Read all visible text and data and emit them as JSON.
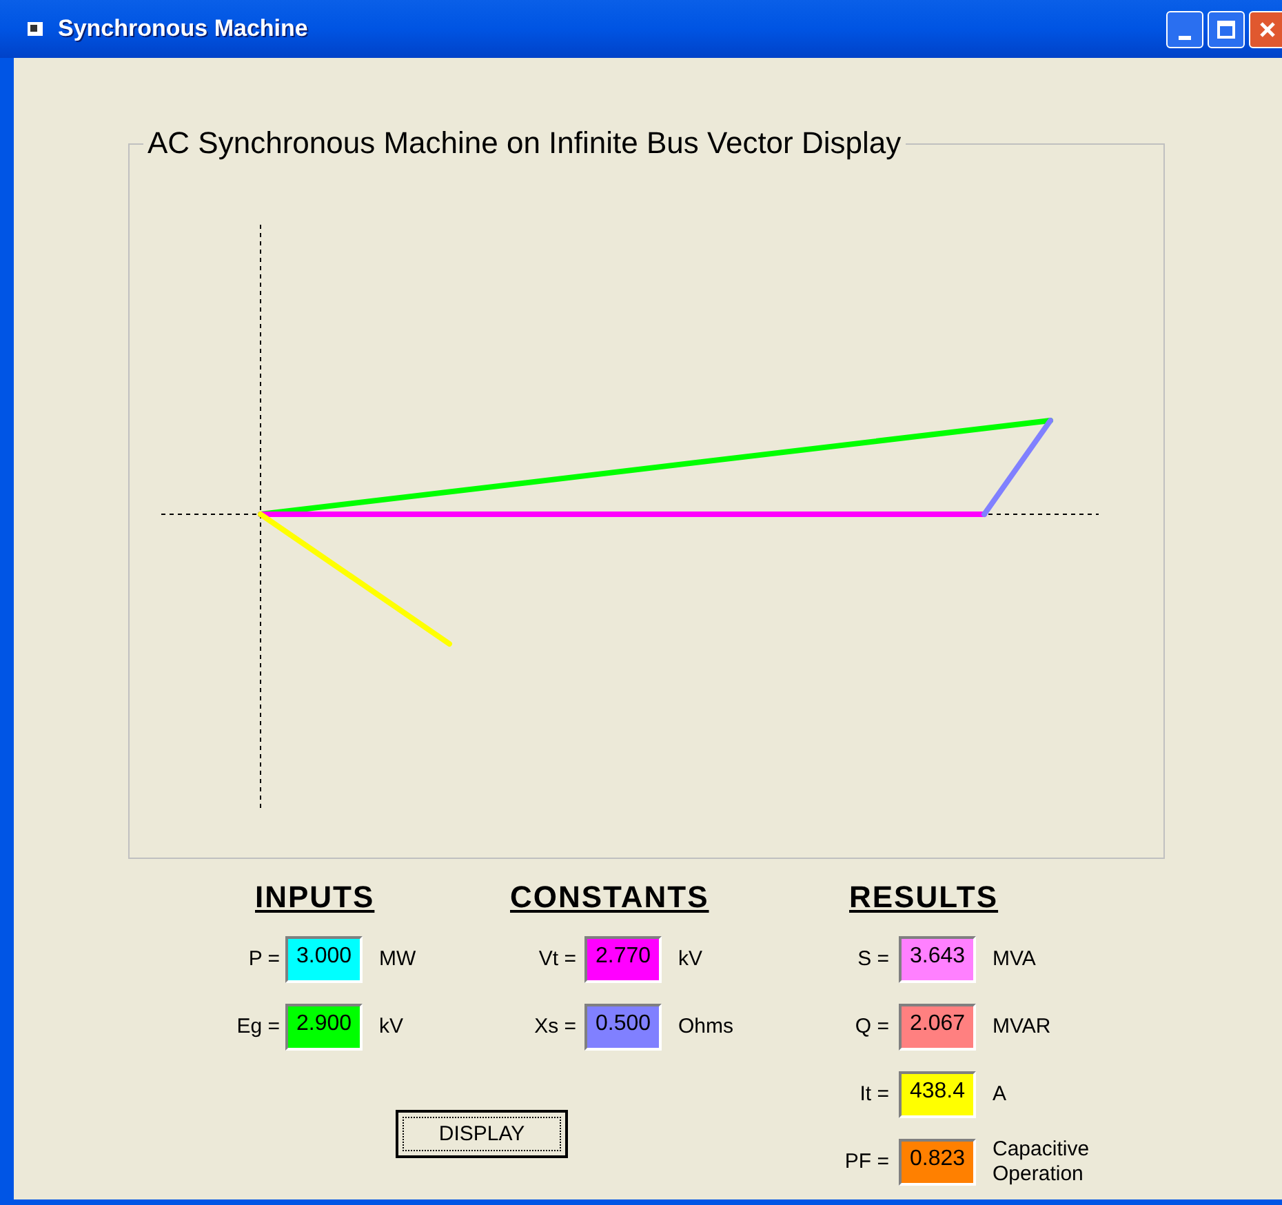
{
  "window": {
    "title": "Synchronous Machine"
  },
  "display": {
    "title": "AC Synchronous Machine on Infinite Bus Vector Display"
  },
  "sections": [
    {
      "heading": "INPUTS",
      "rows": [
        {
          "label": "P =",
          "value": "3.000",
          "unit": "MW",
          "color": "#00ffff"
        },
        {
          "label": "Eg =",
          "value": "2.900",
          "unit": "kV",
          "color": "#00ff00"
        }
      ]
    },
    {
      "heading": "CONSTANTS",
      "rows": [
        {
          "label": "Vt =",
          "value": "2.770",
          "unit": "kV",
          "color": "#ff00ff"
        },
        {
          "label": "Xs =",
          "value": "0.500",
          "unit": "Ohms",
          "color": "#8080ff"
        }
      ]
    },
    {
      "heading": "RESULTS",
      "rows": [
        {
          "label": "S =",
          "value": "3.643",
          "unit": "MVA",
          "color": "#ff80ff"
        },
        {
          "label": "Q =",
          "value": "2.067",
          "unit": "MVAR",
          "color": "#ff8080"
        },
        {
          "label": "It =",
          "value": "438.4",
          "unit": "A",
          "color": "#ffff00"
        },
        {
          "label": "PF =",
          "value": "0.823",
          "unit": "Capacitive Operation",
          "color": "#ff8000"
        }
      ]
    }
  ],
  "display_button": {
    "label": "DISPLAY"
  }
}
